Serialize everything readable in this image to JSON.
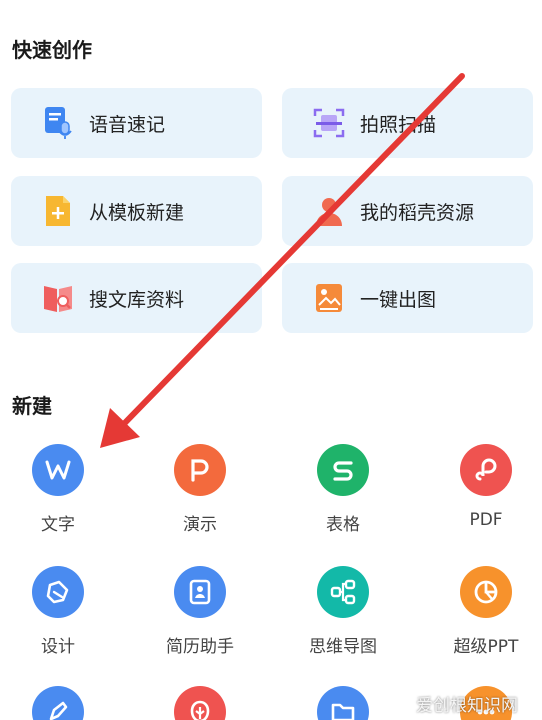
{
  "quick_create": {
    "title": "快速创作",
    "items": [
      {
        "label": "语音速记",
        "icon": "voice-note-icon"
      },
      {
        "label": "拍照扫描",
        "icon": "scan-icon"
      },
      {
        "label": "从模板新建",
        "icon": "template-icon"
      },
      {
        "label": "我的稻壳资源",
        "icon": "user-resource-icon"
      },
      {
        "label": "搜文库资料",
        "icon": "library-search-icon"
      },
      {
        "label": "一键出图",
        "icon": "image-generate-icon"
      }
    ]
  },
  "new_section": {
    "title": "新建",
    "items": [
      {
        "label": "文字",
        "icon": "writer-icon",
        "color": "#4a8bf0"
      },
      {
        "label": "演示",
        "icon": "presentation-icon",
        "color": "#f36a3d"
      },
      {
        "label": "表格",
        "icon": "spreadsheet-icon",
        "color": "#1fb36a"
      },
      {
        "label": "PDF",
        "icon": "pdf-icon",
        "color": "#ef5350"
      },
      {
        "label": "设计",
        "icon": "design-icon",
        "color": "#4a8bf0"
      },
      {
        "label": "简历助手",
        "icon": "resume-icon",
        "color": "#4a8bf0"
      },
      {
        "label": "思维导图",
        "icon": "mindmap-icon",
        "color": "#13b9a8"
      },
      {
        "label": "超级PPT",
        "icon": "super-ppt-icon",
        "color": "#f7922c"
      },
      {
        "label": "",
        "icon": "sign-icon",
        "color": "#4a8bf0"
      },
      {
        "label": "",
        "icon": "form-icon",
        "color": "#ef5350"
      },
      {
        "label": "",
        "icon": "folder-icon",
        "color": "#4a8bf0"
      },
      {
        "label": "",
        "icon": "more-icon",
        "color": "#f7922c"
      }
    ]
  },
  "watermark": "爱创根知识网",
  "colors": {
    "card_bg": "#e8f3fb",
    "annotation_arrow": "#e53935"
  }
}
